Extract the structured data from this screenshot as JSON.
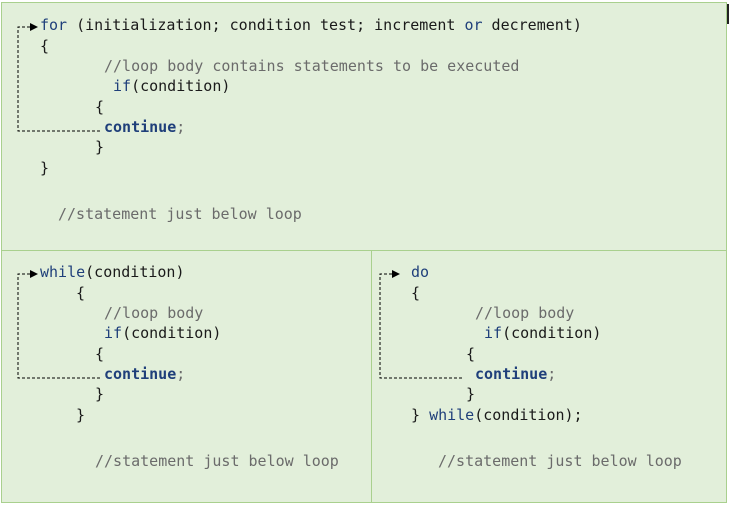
{
  "for_section": {
    "line1": {
      "kw": "for",
      "text": " (initialization; condition test; increment ",
      "kw2": "or",
      "text2": " decrement)"
    },
    "open_brace": "{",
    "comment": "//loop body contains statements to be executed",
    "if_kw": "if",
    "if_cond": "(condition)",
    "inner_open": "{",
    "continue_kw": "continue",
    "continue_semi": ";",
    "inner_close": "}",
    "close_brace": "}",
    "after_comment": "//statement just below loop"
  },
  "while_section": {
    "kw": "while",
    "cond": "(condition)",
    "open_brace": "{",
    "comment": "//loop body",
    "if_kw": "if",
    "if_cond": "(condition)",
    "inner_open": "{",
    "continue_kw": "continue",
    "continue_semi": ";",
    "inner_close": "}",
    "close_brace": "}",
    "after_comment": "//statement just below loop"
  },
  "do_section": {
    "kw": "do",
    "open_brace": "{",
    "comment": "//loop body",
    "if_kw": "if",
    "if_cond": "(condition)",
    "inner_open": "{",
    "continue_kw": "continue",
    "continue_semi": ";",
    "inner_close": "}",
    "close_prefix": "} ",
    "while_kw": "while",
    "close_suffix": "(condition);",
    "after_comment": "//statement just below loop"
  },
  "colors": {
    "panel_bg": "#e2efda",
    "panel_border": "#a9d08e",
    "keyword": "#1f3f7a",
    "comment": "#6b6b6b",
    "arrow": "#000000"
  }
}
